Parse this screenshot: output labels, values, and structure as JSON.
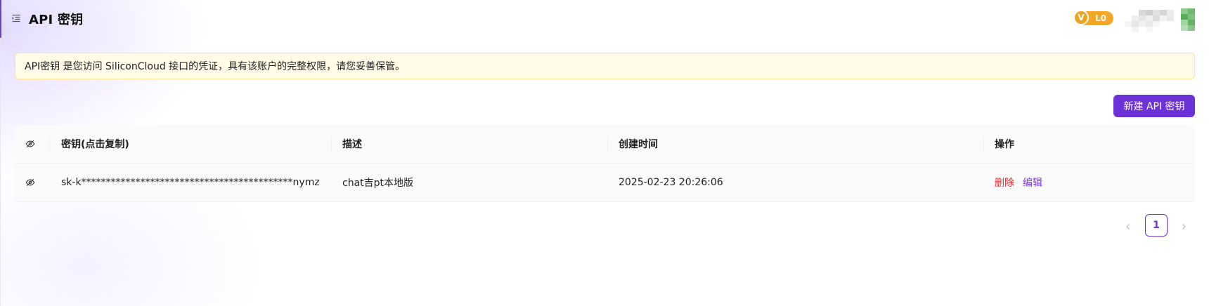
{
  "header": {
    "title": "API 密钥",
    "level_badge": {
      "mark": "V",
      "label": "L0"
    }
  },
  "notice": {
    "text": "API密钥 是您访问 SiliconCloud 接口的凭证，具有该账户的完整权限，请您妥善保管。"
  },
  "toolbar": {
    "create_label": "新建 API 密钥"
  },
  "table": {
    "columns": [
      "密钥(点击复制)",
      "描述",
      "创建时间",
      "操作"
    ],
    "rows": [
      {
        "key": "sk-k*******************************************nymz",
        "description": "chat吉pt本地版",
        "created_at": "2025-02-23 20:26:06",
        "actions": {
          "delete": "删除",
          "edit": "编辑"
        }
      }
    ]
  },
  "pagination": {
    "current_page": "1",
    "prev_icon": "chevron-left-icon",
    "next_icon": "chevron-right-icon"
  },
  "icons": {
    "menu": "menu-fold-icon",
    "visibility": "eye-slash-icon"
  },
  "colors": {
    "primary": "#6d31d8",
    "danger": "#f5222d",
    "notice_bg": "#fffbe6",
    "notice_border": "#ffe58f",
    "badge": "#f5a623"
  }
}
